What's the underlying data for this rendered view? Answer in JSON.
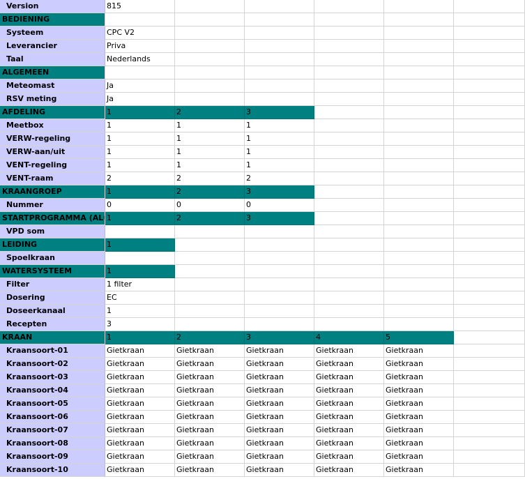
{
  "rows": [
    {
      "type": "label",
      "label": "Version",
      "values": [
        "815"
      ]
    },
    {
      "type": "header",
      "label": "BEDIENING",
      "teal": 0,
      "values": []
    },
    {
      "type": "label",
      "label": "Systeem",
      "values": [
        "CPC V2"
      ]
    },
    {
      "type": "label",
      "label": "Leverancier",
      "values": [
        "Priva"
      ]
    },
    {
      "type": "label",
      "label": "Taal",
      "values": [
        "Nederlands"
      ]
    },
    {
      "type": "header",
      "label": "ALGEMEEN",
      "teal": 0,
      "values": []
    },
    {
      "type": "label",
      "label": "Meteomast",
      "values": [
        "Ja"
      ]
    },
    {
      "type": "label",
      "label": "RSV meting",
      "values": [
        "Ja"
      ]
    },
    {
      "type": "header",
      "label": "AFDELING",
      "teal": 3,
      "values": [
        "1",
        "2",
        "3"
      ]
    },
    {
      "type": "label",
      "label": "Meetbox",
      "values": [
        "1",
        "1",
        "1"
      ]
    },
    {
      "type": "label",
      "label": "VERW-regeling",
      "values": [
        "1",
        "1",
        "1"
      ]
    },
    {
      "type": "label",
      "label": "VERW-aan/uit",
      "values": [
        "1",
        "1",
        "1"
      ]
    },
    {
      "type": "label",
      "label": "VENT-regeling",
      "values": [
        "1",
        "1",
        "1"
      ]
    },
    {
      "type": "label",
      "label": "VENT-raam",
      "values": [
        "2",
        "2",
        "2"
      ]
    },
    {
      "type": "header",
      "label": "KRAANGROEP",
      "teal": 3,
      "values": [
        "1",
        "2",
        "3"
      ]
    },
    {
      "type": "label",
      "label": "Nummer",
      "values": [
        "0",
        "0",
        "0"
      ]
    },
    {
      "type": "header",
      "label": "STARTPROGRAMMA (ALGE",
      "teal": 3,
      "values": [
        "1",
        "2",
        "3"
      ]
    },
    {
      "type": "label",
      "label": "VPD som",
      "values": []
    },
    {
      "type": "header",
      "label": "LEIDING",
      "teal": 1,
      "values": [
        "1"
      ]
    },
    {
      "type": "label",
      "label": "Spoelkraan",
      "values": []
    },
    {
      "type": "header",
      "label": "WATERSYSTEEM",
      "teal": 1,
      "values": [
        "1"
      ]
    },
    {
      "type": "label",
      "label": "Filter",
      "values": [
        "1 filter"
      ]
    },
    {
      "type": "label",
      "label": "Dosering",
      "values": [
        "EC"
      ]
    },
    {
      "type": "label",
      "label": "Doseerkanaal",
      "values": [
        "1"
      ]
    },
    {
      "type": "label",
      "label": "Recepten",
      "values": [
        "3"
      ]
    },
    {
      "type": "header",
      "label": "KRAAN",
      "teal": 5,
      "values": [
        "1",
        "2",
        "3",
        "4",
        "5"
      ]
    },
    {
      "type": "label",
      "label": "Kraansoort-01",
      "values": [
        "Gietkraan",
        "Gietkraan",
        "Gietkraan",
        "Gietkraan",
        "Gietkraan"
      ]
    },
    {
      "type": "label",
      "label": "Kraansoort-02",
      "values": [
        "Gietkraan",
        "Gietkraan",
        "Gietkraan",
        "Gietkraan",
        "Gietkraan"
      ]
    },
    {
      "type": "label",
      "label": "Kraansoort-03",
      "values": [
        "Gietkraan",
        "Gietkraan",
        "Gietkraan",
        "Gietkraan",
        "Gietkraan"
      ]
    },
    {
      "type": "label",
      "label": "Kraansoort-04",
      "values": [
        "Gietkraan",
        "Gietkraan",
        "Gietkraan",
        "Gietkraan",
        "Gietkraan"
      ]
    },
    {
      "type": "label",
      "label": "Kraansoort-05",
      "values": [
        "Gietkraan",
        "Gietkraan",
        "Gietkraan",
        "Gietkraan",
        "Gietkraan"
      ]
    },
    {
      "type": "label",
      "label": "Kraansoort-06",
      "values": [
        "Gietkraan",
        "Gietkraan",
        "Gietkraan",
        "Gietkraan",
        "Gietkraan"
      ]
    },
    {
      "type": "label",
      "label": "Kraansoort-07",
      "values": [
        "Gietkraan",
        "Gietkraan",
        "Gietkraan",
        "Gietkraan",
        "Gietkraan"
      ]
    },
    {
      "type": "label",
      "label": "Kraansoort-08",
      "values": [
        "Gietkraan",
        "Gietkraan",
        "Gietkraan",
        "Gietkraan",
        "Gietkraan"
      ]
    },
    {
      "type": "label",
      "label": "Kraansoort-09",
      "values": [
        "Gietkraan",
        "Gietkraan",
        "Gietkraan",
        "Gietkraan",
        "Gietkraan"
      ]
    },
    {
      "type": "label",
      "label": "Kraansoort-10",
      "values": [
        "Gietkraan",
        "Gietkraan",
        "Gietkraan",
        "Gietkraan",
        "Gietkraan"
      ]
    }
  ],
  "colors": {
    "label_bg": "#ccccff",
    "header_bg": "#008080",
    "grid_line": "#d4d4d4"
  }
}
